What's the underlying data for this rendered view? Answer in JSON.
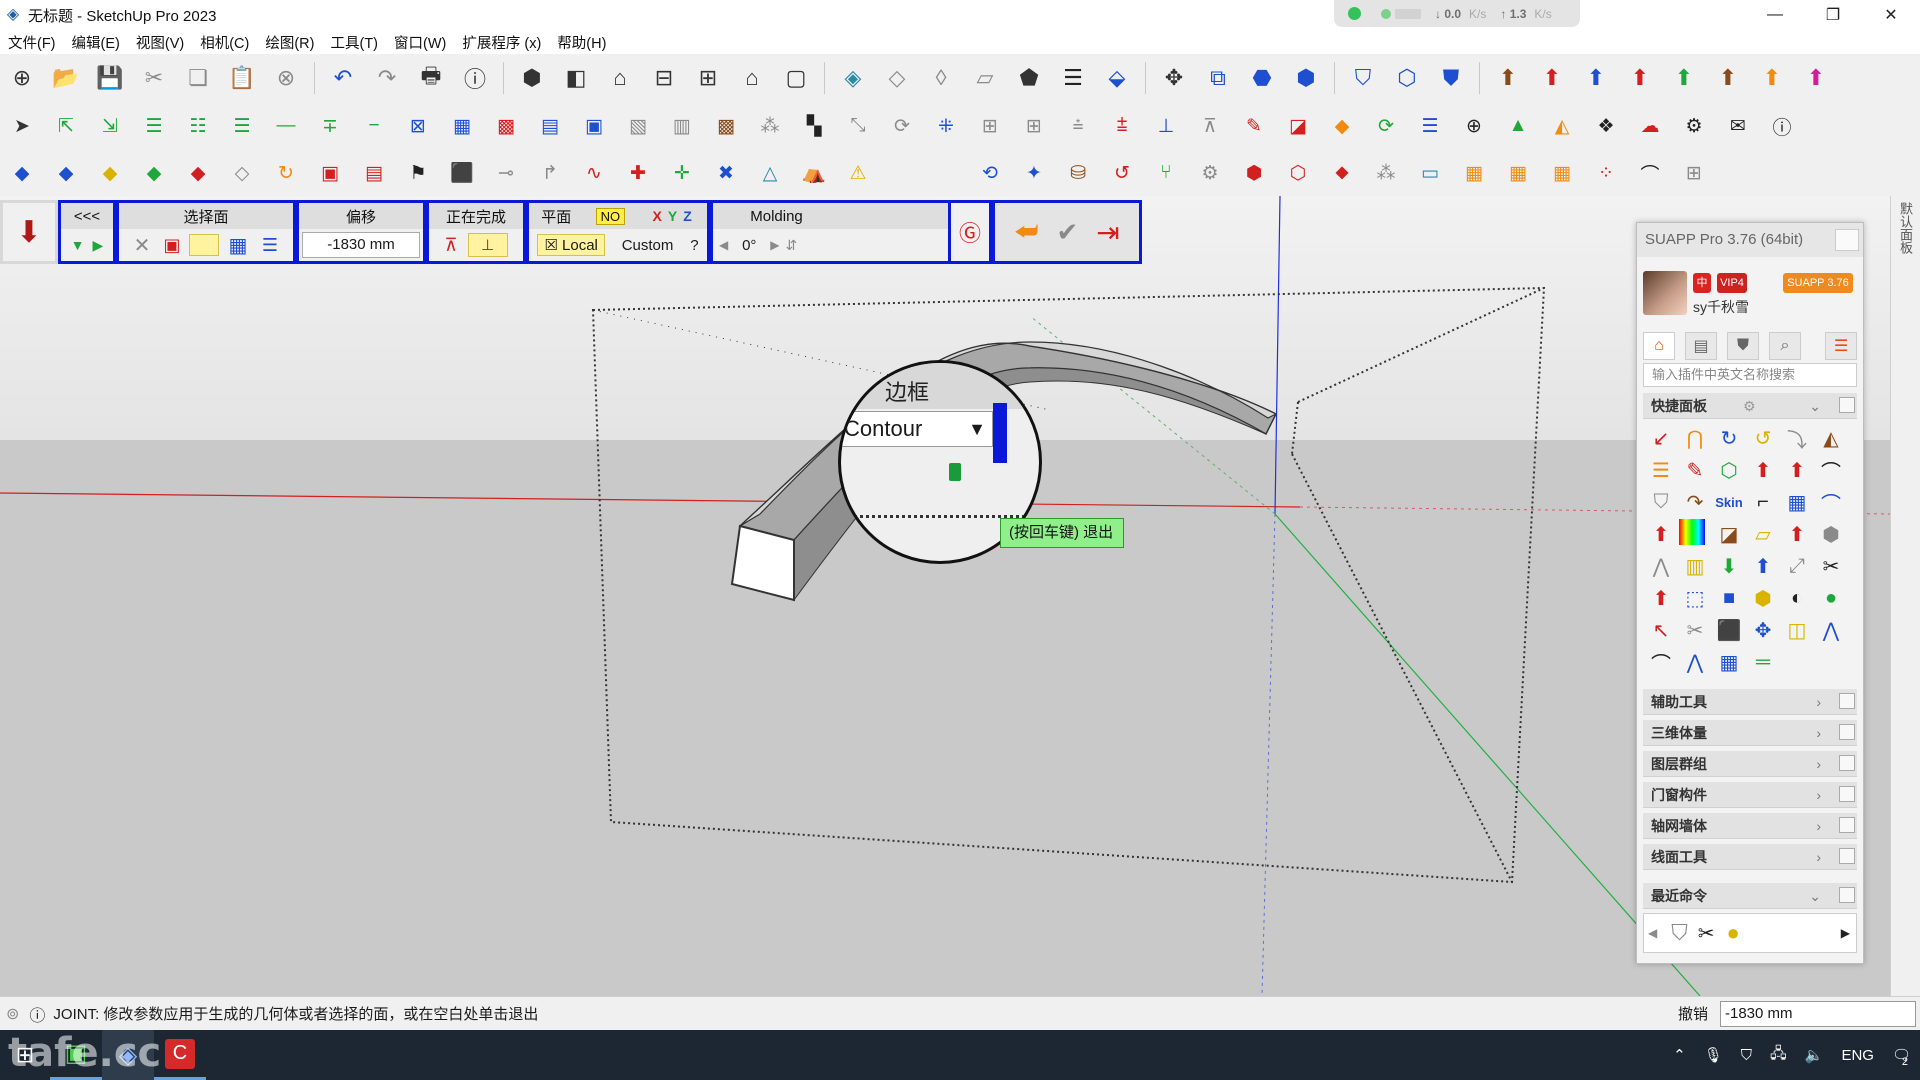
{
  "window": {
    "title": "无标题 - SketchUp Pro 2023",
    "net_down": "0.0",
    "net_up": "1.3",
    "net_unit": "K/s"
  },
  "menu": [
    "文件(F)",
    "编辑(E)",
    "视图(V)",
    "相机(C)",
    "绘图(R)",
    "工具(T)",
    "窗口(W)",
    "扩展程序 (x)",
    "帮助(H)"
  ],
  "joint_panel": {
    "nav_label": "<<<",
    "select_face_label": "选择面",
    "offset_label": "偏移",
    "offset_value": "-1830 mm",
    "finishing_label": "正在完成",
    "plane_label": "平面",
    "no_badge": "NO",
    "axis_x": "X",
    "axis_y": "Y",
    "axis_z": "Z",
    "local_label": "Local",
    "custom_label": "Custom",
    "help_label": "?",
    "molding_label": "Molding",
    "angle_value": "0°",
    "contour_header": "边框",
    "contour_value": "Contour"
  },
  "tooltip": "(按回车键) 退出",
  "suapp": {
    "title": "SUAPP Pro 3.76 (64bit)",
    "user": "sy千秋雪",
    "vip_label": "VIP4",
    "version_badge": "SUAPP 3.76",
    "lang_badge": "中",
    "search_placeholder": "输入插件中英文名称搜索",
    "quick_panel": "快捷面板",
    "sections": [
      "辅助工具",
      "三维体量",
      "图层群组",
      "门窗构件",
      "轴网墙体",
      "线面工具"
    ],
    "recent": "最近命令",
    "skin_label": "Skin"
  },
  "right_tab": "默认面板",
  "status": {
    "message": "JOINT: 修改参数应用于生成的几何体或者选择的面，或在空白处单击退出",
    "undo_label": "撤销",
    "measure_value": "-1830 mm"
  },
  "taskbar": {
    "lang": "ENG",
    "notif_count": "2"
  },
  "watermark": "tafe.cc",
  "colors": {
    "joint_border": "#0a18d8",
    "tooltip_bg": "#8ff08a",
    "axis_red": "#d02020",
    "axis_green": "#20b040",
    "axis_blue": "#2030e0"
  }
}
